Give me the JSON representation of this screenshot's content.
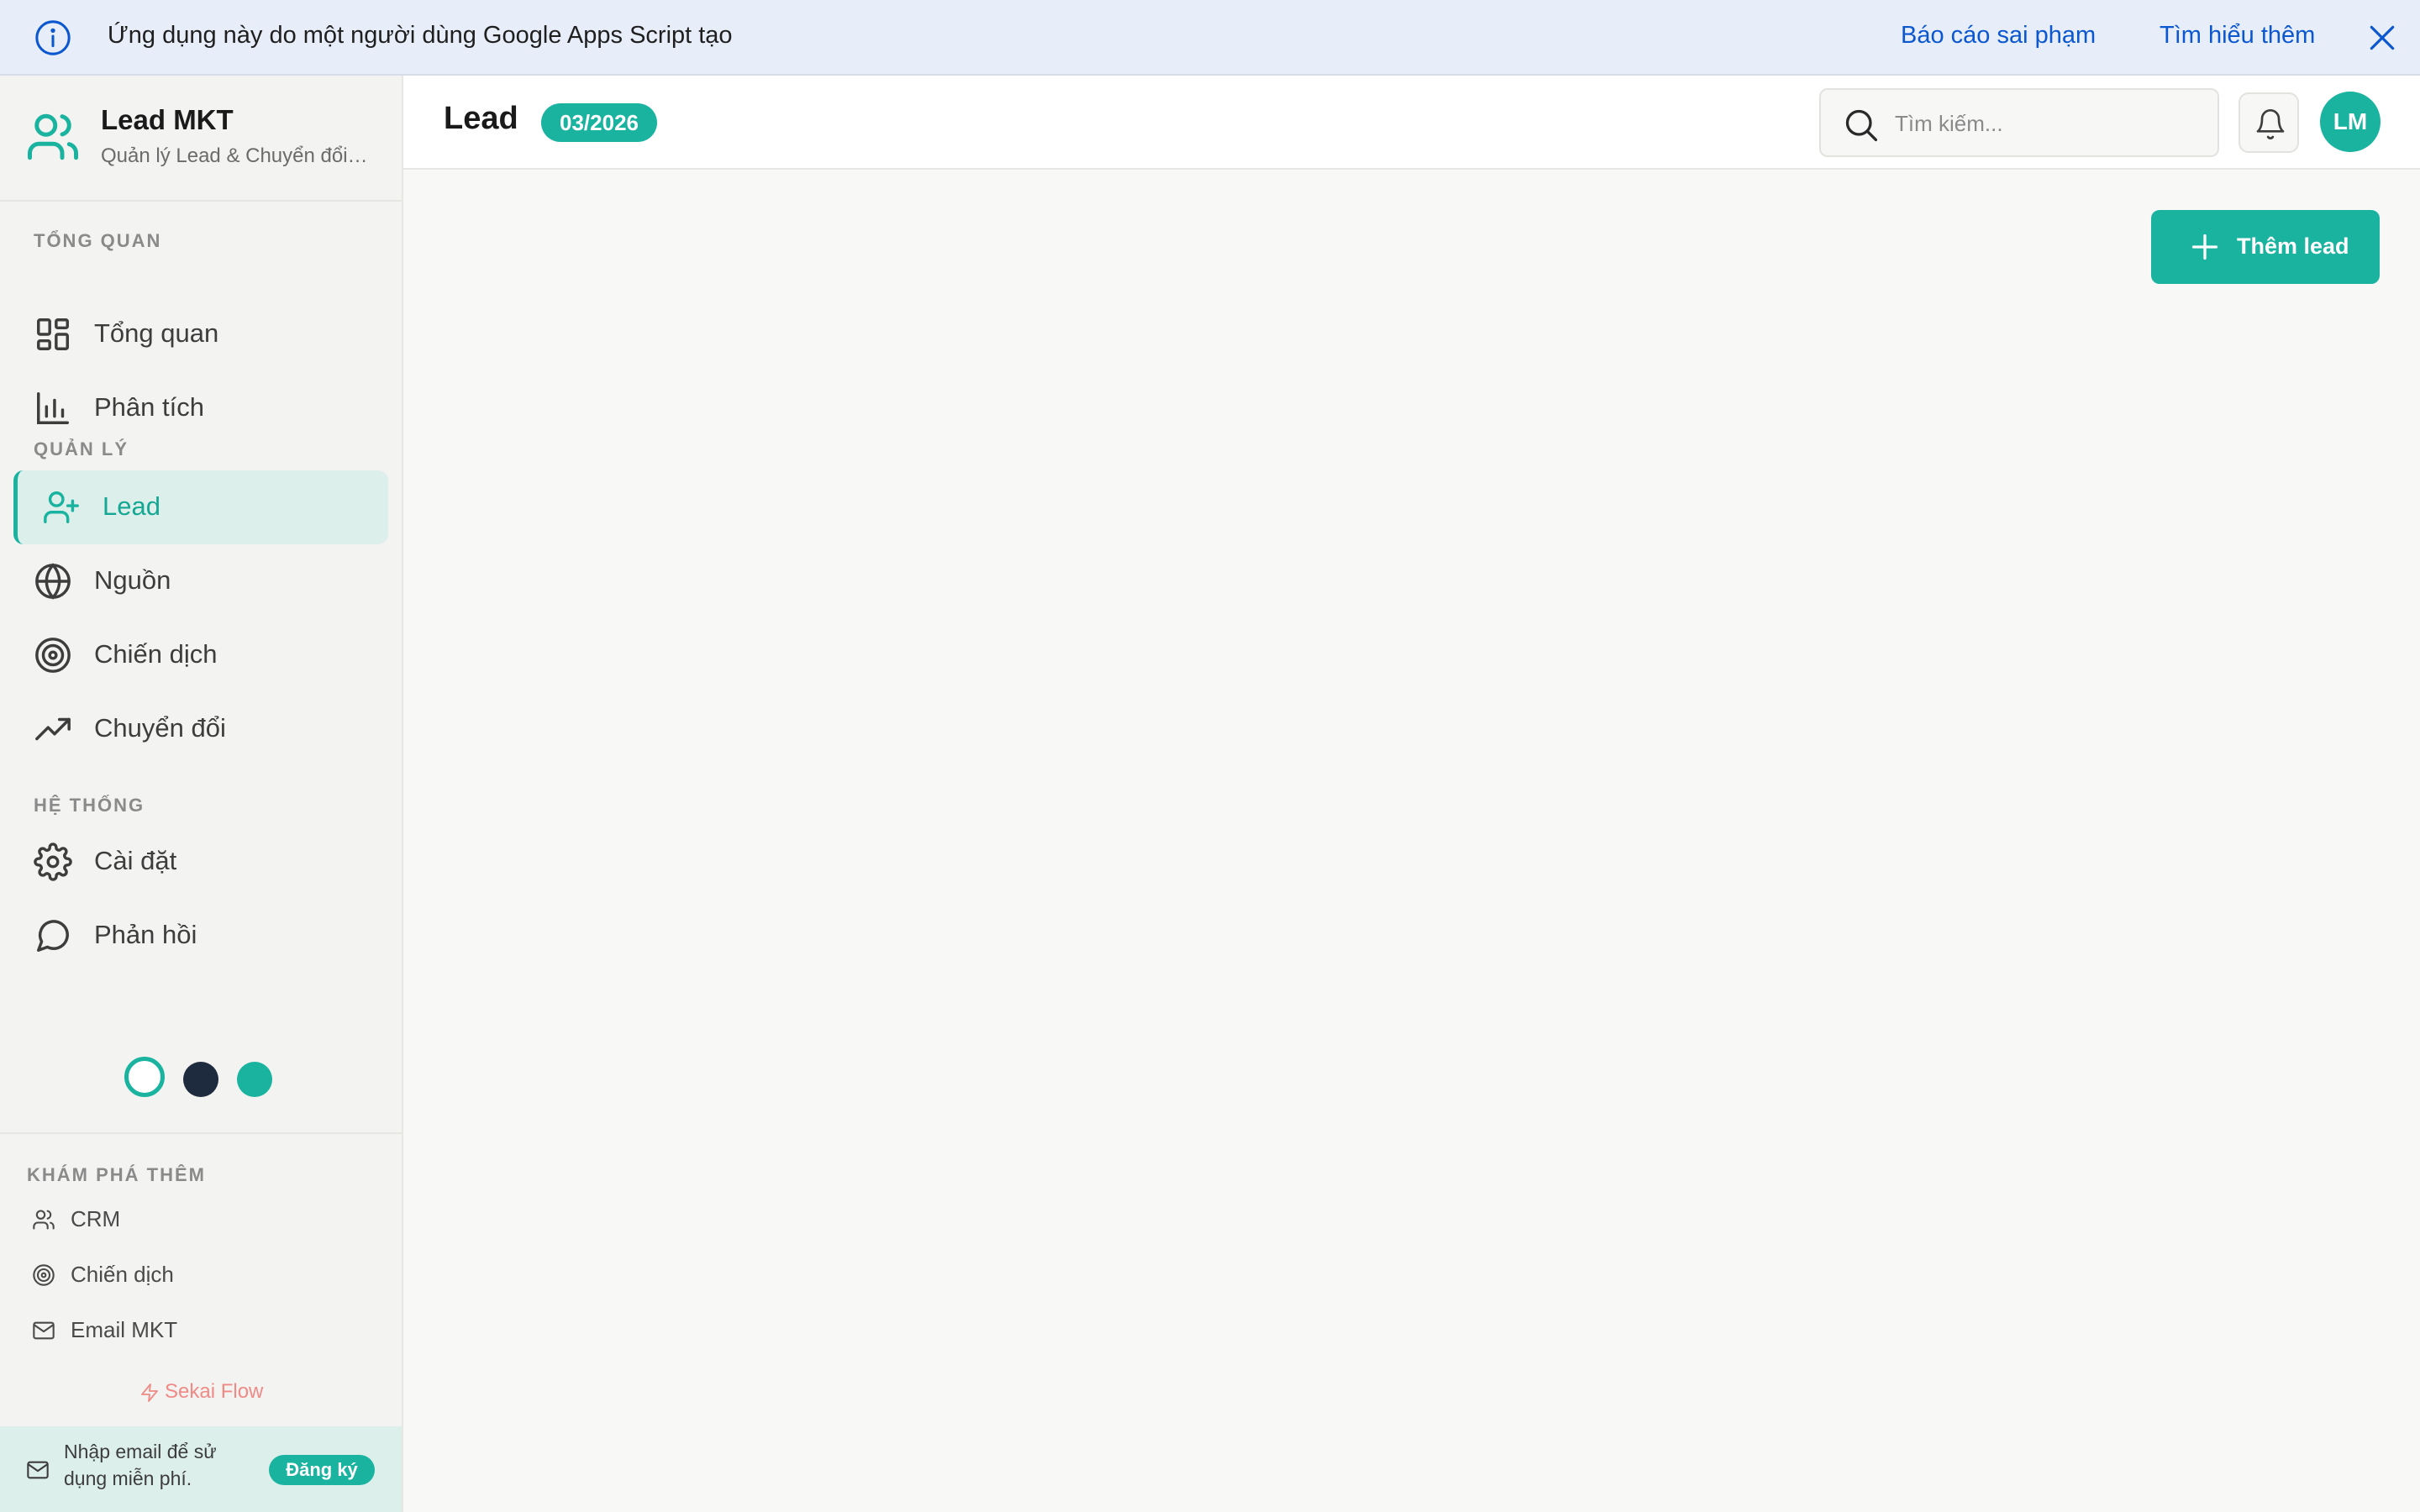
{
  "banner": {
    "message": "Ứng dụng này do một người dùng Google Apps Script tạo",
    "report_link": "Báo cáo sai phạm",
    "learn_more_link": "Tìm hiểu thêm"
  },
  "brand": {
    "title": "Lead MKT",
    "subtitle": "Quản lý Lead & Chuyển đổi Marketing"
  },
  "sidebar": {
    "sections": [
      {
        "label": "TỔNG QUAN",
        "items": [
          {
            "label": "Tổng quan",
            "icon": "dashboard-icon"
          },
          {
            "label": "Phân tích",
            "icon": "bar-chart-icon"
          }
        ]
      },
      {
        "label": "QUẢN LÝ",
        "items": [
          {
            "label": "Lead",
            "icon": "user-plus-icon",
            "active": true
          },
          {
            "label": "Nguồn",
            "icon": "globe-icon"
          },
          {
            "label": "Chiến dịch",
            "icon": "target-icon"
          },
          {
            "label": "Chuyển đổi",
            "icon": "trending-up-icon"
          }
        ]
      },
      {
        "label": "HỆ THỐNG",
        "items": [
          {
            "label": "Cài đặt",
            "icon": "gear-icon"
          },
          {
            "label": "Phản hồi",
            "icon": "message-circle-icon"
          }
        ]
      }
    ],
    "theme_colors": [
      "#ffffff",
      "#1e2a3e",
      "#19b3a0"
    ],
    "explore": {
      "label": "KHÁM PHÁ THÊM",
      "items": [
        {
          "label": "CRM",
          "icon": "users-icon"
        },
        {
          "label": "Chiến dịch",
          "icon": "target-icon"
        },
        {
          "label": "Email MKT",
          "icon": "mail-icon"
        }
      ]
    },
    "powered_by": "Sekai Flow",
    "signup": {
      "text": "Nhập email để sử dụng miễn phí.",
      "button": "Đăng ký"
    }
  },
  "header": {
    "title": "Lead",
    "period": "03/2026",
    "search_placeholder": "Tìm kiếm...",
    "avatar_initials": "LM"
  },
  "main": {
    "add_button": "Thêm lead"
  },
  "colors": {
    "accent": "#19b3a0",
    "accent_light": "#dcefeb",
    "banner_bg": "#e8eef9",
    "link": "#0b57d0",
    "powered_by": "#f08a86"
  }
}
